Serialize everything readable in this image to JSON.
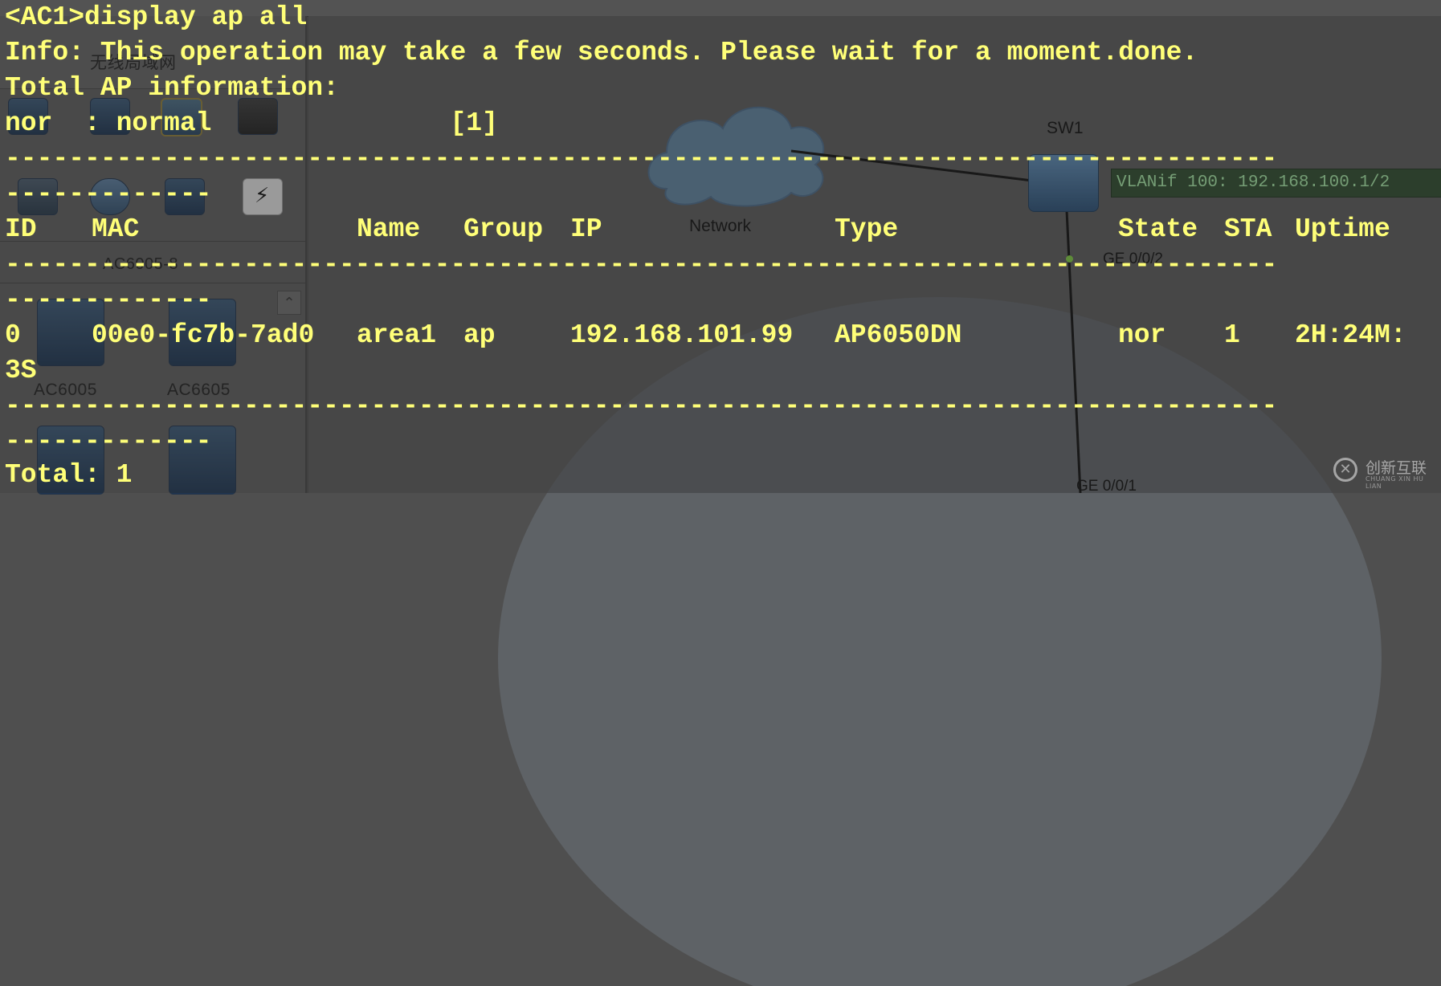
{
  "background": {
    "sidebar": {
      "category_title": "无线局域网",
      "device_group_label": "AC6005-8",
      "device_labels": [
        "AC6005",
        "AC6605"
      ]
    },
    "topology": {
      "cloud_label": "Network",
      "switch_label": "SW1",
      "vlanif_label": "VLANif 100: 192.168.100.1/2",
      "port_top": "GE 0/0/2",
      "port_bottom": "GE 0/0/1"
    },
    "watermark": {
      "logo_glyph": "✕",
      "text": "创新互联",
      "subtext": "CHUANG XIN HU LIAN"
    }
  },
  "terminal": {
    "command_line": "<AC1>display ap all",
    "info_line": "Info: This operation may take a few seconds. Please wait for a moment.done.",
    "section_title": "Total AP information:",
    "legend_line": "nor  : normal               [1]",
    "separator_long": "--------------------------------------------------------------------------------",
    "separator_short": "-------------",
    "columns": {
      "id": "ID",
      "mac": "MAC",
      "name": "Name",
      "group": "Group",
      "ip": "IP",
      "type": "Type",
      "state": "State",
      "sta": "STA",
      "uptime": "Uptime"
    },
    "rows": [
      {
        "id": "0",
        "mac": "00e0-fc7b-7ad0",
        "name": "area1",
        "group": "ap",
        "ip": "192.168.101.99",
        "type": "AP6050DN",
        "state": "nor",
        "sta": "1",
        "uptime": "2H:24M:",
        "uptime_wrap": "3S"
      }
    ],
    "total_line": "Total: 1"
  },
  "colors": {
    "terminal_text": "#ffff78",
    "background": "#4f4f4f"
  }
}
